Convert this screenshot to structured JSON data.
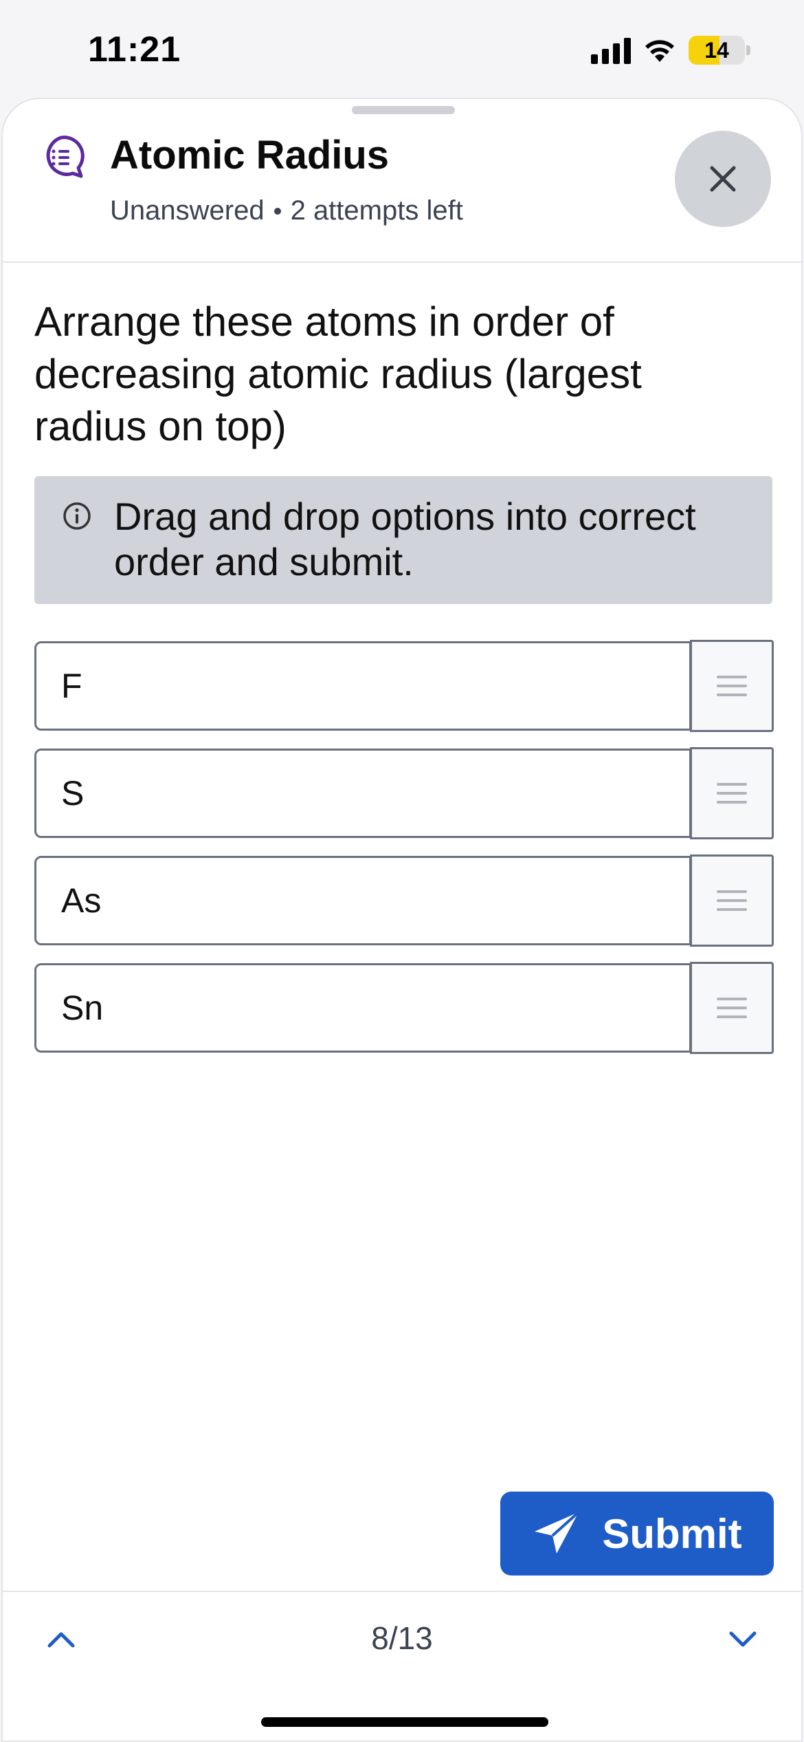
{
  "status": {
    "time": "11:21",
    "battery": "14"
  },
  "header": {
    "title": "Atomic Radius",
    "status": "Unanswered",
    "attempts": "2 attempts left"
  },
  "question": {
    "prompt": "Arrange these atoms in order of decreasing atomic radius (largest radius on top)",
    "hint": "Drag and drop options into correct order and submit."
  },
  "options": [
    "F",
    "S",
    "As",
    "Sn"
  ],
  "footer": {
    "submit_label": "Submit",
    "page_counter": "8/13"
  },
  "colors": {
    "accent": "#1e5cc8",
    "icon_purple": "#5b2a9e",
    "hint_bg": "#d0d3d9"
  },
  "icons": {
    "header": "chat-bubble-list-icon",
    "close": "close-icon",
    "hint": "info-circle-icon",
    "handle": "drag-handle-icon",
    "submit": "paper-plane-icon",
    "nav_prev": "chevron-up-icon",
    "nav_next": "chevron-down-icon"
  }
}
